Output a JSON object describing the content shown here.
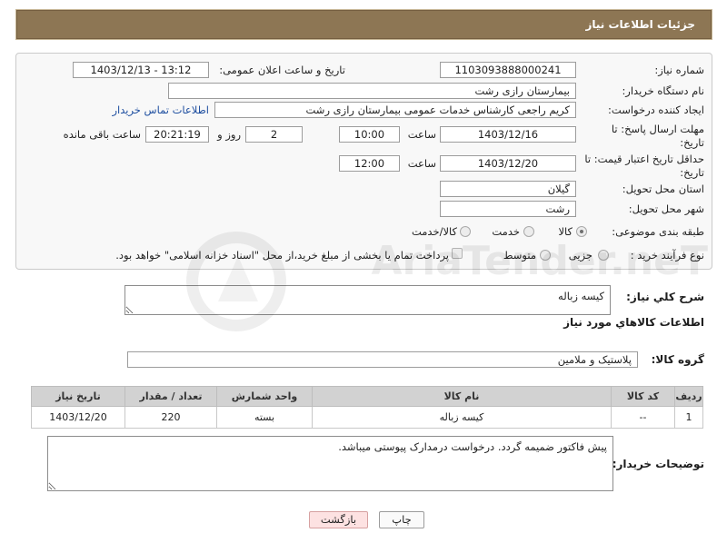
{
  "header": {
    "title": "جزئیات اطلاعات نیاز"
  },
  "form": {
    "need_number": {
      "label": "شماره نیاز:",
      "value": "1103093888000241"
    },
    "announce_datetime": {
      "label": "تاریخ و ساعت اعلان عمومی:",
      "value": "1403/12/13 - 13:12"
    },
    "buyer_org": {
      "label": "نام دستگاه خریدار:",
      "value": "بیمارستان رازی رشت"
    },
    "requester": {
      "label": "ایجاد کننده درخواست:",
      "value": "کریم راجعی کارشناس خدمات عمومی بیمارستان رازی رشت",
      "contact_link": "اطلاعات تماس خریدار"
    },
    "reply_deadline": {
      "label_line1": "مهلت ارسال پاسخ: تا",
      "label_line2": "تاریخ:",
      "date": "1403/12/16",
      "time_label": "ساعت",
      "time": "10:00",
      "days": "2",
      "days_label": "روز و",
      "remaining_time": "20:21:19",
      "remaining_label": "ساعت باقی مانده"
    },
    "price_validity": {
      "label_line1": "حداقل تاریخ اعتبار قیمت: تا",
      "label_line2": "تاریخ:",
      "date": "1403/12/20",
      "time_label": "ساعت",
      "time": "12:00"
    },
    "province": {
      "label": "استان محل تحویل:",
      "value": "گیلان"
    },
    "city": {
      "label": "شهر محل تحویل:",
      "value": "رشت"
    },
    "category": {
      "label": "طبقه بندی موضوعی:",
      "options": [
        "کالا",
        "خدمت",
        "کالا/خدمت"
      ],
      "selected": "کالا"
    },
    "purchase_process": {
      "label": "نوع فرآیند خرید :",
      "options": [
        "جزیی",
        "متوسط"
      ],
      "selected": null,
      "treasury_note": "پرداخت تمام یا بخشی از مبلغ خرید،از محل \"اسناد خزانه اسلامی\" خواهد بود.",
      "treasury_checked": false
    }
  },
  "description": {
    "label": "شرح کلي نياز:",
    "value": "کیسه زباله"
  },
  "goods": {
    "section_title": "اطلاعات کالاهاي مورد نياز",
    "group_label": "گروه کالا:",
    "group_value": "پلاستیک و ملامین",
    "columns": [
      "ردیف",
      "کد کالا",
      "نام کالا",
      "واحد شمارش",
      "تعداد / مقدار",
      "تاریخ نیاز"
    ],
    "rows": [
      [
        "1",
        "--",
        "کیسه زباله",
        "بسته",
        "220",
        "1403/12/20"
      ]
    ]
  },
  "buyer_notes": {
    "label": "توضیحات خریدار:",
    "value": "پیش فاکتور ضمیمه گردد. درخواست درمدارک پیوستی میباشد."
  },
  "buttons": {
    "print": "چاپ",
    "back": "بازگشت"
  },
  "watermark": {
    "text": "AriaTender.neT"
  },
  "colors": {
    "header_bg": "#8d7654",
    "header_text": "#ffffff",
    "link": "#1f4fa0",
    "table_header_bg": "#d2d2d2",
    "back_button_bg": "#fde2e2"
  }
}
